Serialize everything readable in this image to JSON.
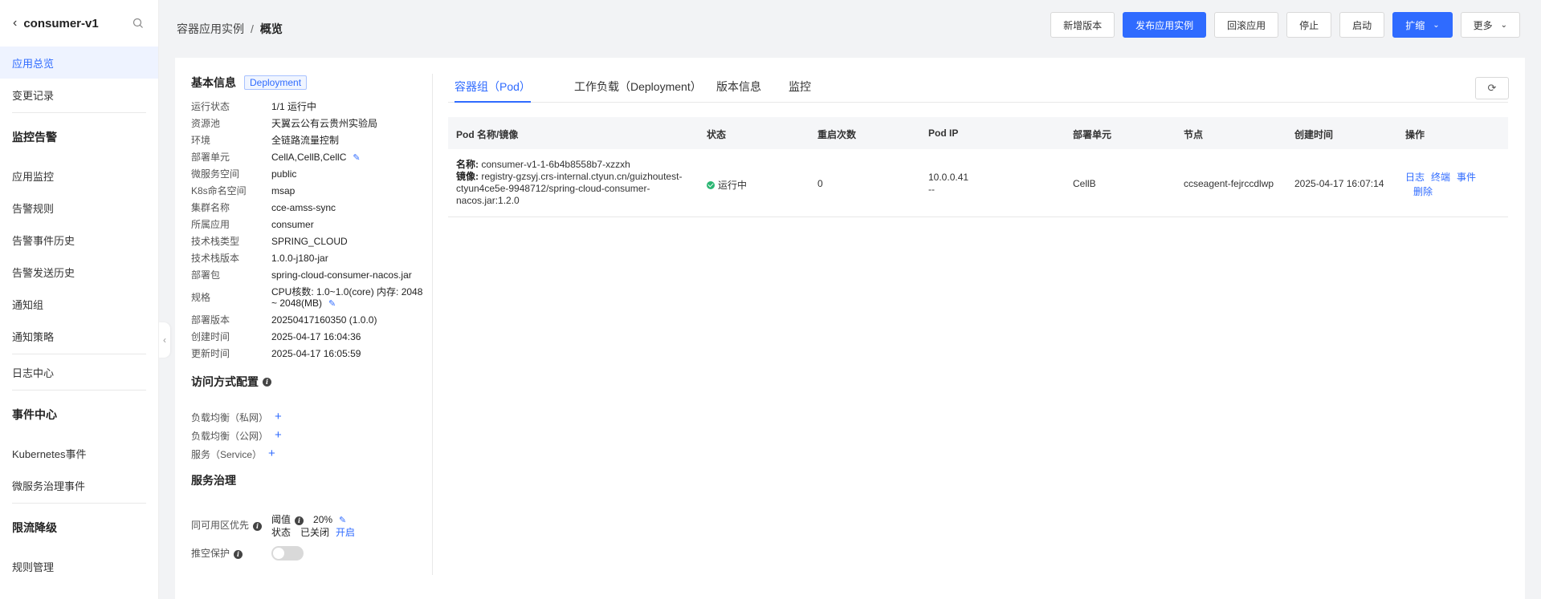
{
  "sidebar": {
    "title": "consumer-v1",
    "items": [
      {
        "label": "应用总览",
        "active": true
      },
      {
        "label": "变更记录"
      }
    ],
    "monitor_group": "监控告警",
    "monitor_items": [
      "应用监控",
      "告警规则",
      "告警事件历史",
      "告警发送历史",
      "通知组",
      "通知策略"
    ],
    "log_item": "日志中心",
    "event_group": "事件中心",
    "event_items": [
      "Kubernetes事件",
      "微服务治理事件"
    ],
    "limit_group": "限流降级",
    "limit_items": [
      "规则管理"
    ]
  },
  "breadcrumb": {
    "parent": "容器应用实例",
    "sep": "/",
    "current": "概览"
  },
  "actions": {
    "new_version": "新增版本",
    "publish": "发布应用实例",
    "rollback": "回滚应用",
    "stop": "停止",
    "start": "启动",
    "scale": "扩缩",
    "more": "更多"
  },
  "basic_info": {
    "title": "基本信息",
    "tag": "Deployment",
    "rows": [
      {
        "k": "运行状态",
        "v": "1/1 运行中"
      },
      {
        "k": "资源池",
        "v": "天翼云公有云贵州实验局"
      },
      {
        "k": "环境",
        "v": "全链路流量控制"
      },
      {
        "k": "部署单元",
        "v": "CellA,CellB,CellC"
      },
      {
        "k": "微服务空间",
        "v": "public"
      },
      {
        "k": "K8s命名空间",
        "v": "msap"
      },
      {
        "k": "集群名称",
        "v": "cce-amss-sync"
      },
      {
        "k": "所属应用",
        "v": "consumer"
      },
      {
        "k": "技术栈类型",
        "v": "SPRING_CLOUD"
      },
      {
        "k": "技术栈版本",
        "v": "1.0.0-j180-jar"
      },
      {
        "k": "部署包",
        "v": "spring-cloud-consumer-nacos.jar"
      },
      {
        "k": "规格",
        "v": "CPU核数: 1.0~1.0(core) 内存: 2048 ~ 2048(MB)"
      },
      {
        "k": "部署版本",
        "v": "20250417160350 (1.0.0)"
      },
      {
        "k": "创建时间",
        "v": "2025-04-17 16:04:36"
      },
      {
        "k": "更新时间",
        "v": "2025-04-17 16:05:59"
      }
    ]
  },
  "access": {
    "title": "访问方式配置",
    "rows": [
      "负载均衡（私网）",
      "负载均衡（公网）",
      "服务（Service）"
    ]
  },
  "governance": {
    "title": "服务治理",
    "zone_label": "同可用区优先",
    "threshold_label": "阈值",
    "threshold_value": "20%",
    "status_label": "状态",
    "status_value": "已关闭",
    "enable_link": "开启",
    "push_label": "推空保护"
  },
  "tabs": [
    "容器组（Pod）",
    "工作负载（Deployment）",
    "版本信息",
    "监控"
  ],
  "table": {
    "headers": [
      "Pod 名称/镜像",
      "状态",
      "重启次数",
      "Pod IP",
      "部署单元",
      "节点",
      "创建时间",
      "操作"
    ],
    "row": {
      "name_label": "名称:",
      "name": "consumer-v1-1-6b4b8558b7-xzzxh",
      "image_label": "镜像:",
      "image": "registry-gzsyj.crs-internal.ctyun.cn/guizhoutest-ctyun4ce5e-9948712/spring-cloud-consumer-nacos.jar:1.2.0",
      "status": "运行中",
      "restarts": "0",
      "ip": "10.0.0.41",
      "ip2": "--",
      "cell": "CellB",
      "node": "ccseagent-fejrccdlwp",
      "created": "2025-04-17 16:07:14",
      "ops": [
        "日志",
        "终端",
        "事件",
        "删除"
      ]
    }
  }
}
